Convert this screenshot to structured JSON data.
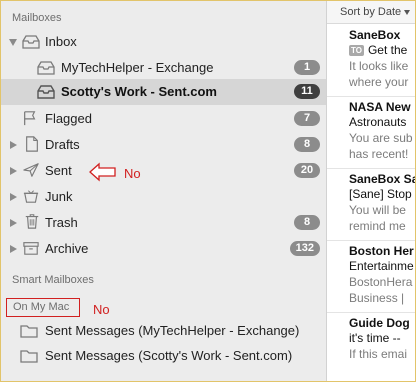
{
  "sidebar": {
    "mailboxes_header": "Mailboxes",
    "smart_header": "Smart Mailboxes",
    "on_my_mac_header": "On My Mac",
    "inbox": {
      "label": "Inbox",
      "accounts": [
        {
          "label": "MyTechHelper - Exchange",
          "badge": "1"
        },
        {
          "label": "Scotty's Work - Sent.com",
          "badge": "11",
          "selected": true
        }
      ]
    },
    "flagged": {
      "label": "Flagged",
      "badge": "7"
    },
    "drafts": {
      "label": "Drafts",
      "badge": "8"
    },
    "sent": {
      "label": "Sent",
      "badge": "20"
    },
    "junk": {
      "label": "Junk"
    },
    "trash": {
      "label": "Trash",
      "badge": "8"
    },
    "archive": {
      "label": "Archive",
      "badge": "132"
    },
    "local_folders": [
      {
        "label": "Sent Messages (MyTechHelper - Exchange)"
      },
      {
        "label": "Sent Messages (Scotty's Work - Sent.com)"
      }
    ]
  },
  "annotations": {
    "sent_note": "No",
    "on_my_mac_note": "No",
    "color": "#d12020"
  },
  "message_list": {
    "sort_label": "Sort by Date",
    "messages": [
      {
        "sender": "SaneBox",
        "badge": "TO",
        "subject": "Get the",
        "preview1": "It looks like",
        "preview2": "where your"
      },
      {
        "sender": "NASA New",
        "subject": "Astronauts",
        "preview1": "You are sub",
        "preview2": "has recent!"
      },
      {
        "sender": "SaneBox Sa",
        "subject": "[Sane] Stop",
        "preview1": "You will be",
        "preview2": "remind me"
      },
      {
        "sender": "Boston Her",
        "subject": "Entertainme",
        "preview1": "BostonHera",
        "preview2": "Business |"
      },
      {
        "sender": "Guide Dog",
        "subject": "it's time --",
        "preview1": "If this emai",
        "preview2": ""
      }
    ]
  },
  "colors": {
    "accent_border": "#e2c46a",
    "selected_row": "#d6d6d6",
    "badge": "#8c8c8c",
    "badge_selected": "#3f3f3f"
  }
}
